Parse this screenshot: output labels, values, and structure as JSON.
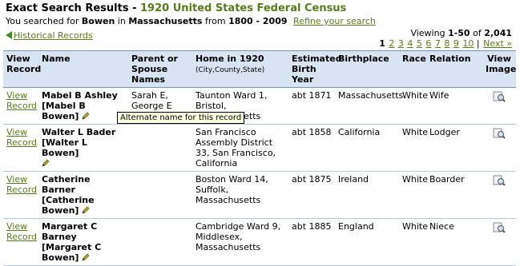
{
  "header": {
    "title_prefix": "Exact Search Results - ",
    "title_db": "1920 United States Federal Census",
    "search_prefix": "You searched for ",
    "search_name": "Bowen",
    "search_in": " in ",
    "search_place": "Massachusetts",
    "search_from": " from ",
    "search_years": "1800 - 2009",
    "refine_link": "Refine your search"
  },
  "nav": {
    "back_label": "Historical Records"
  },
  "paging": {
    "viewing_prefix": "Viewing ",
    "range": "1-50",
    "of": " of ",
    "total": "2,041",
    "current_page": "1",
    "pages": [
      "2",
      "3",
      "4",
      "5",
      "6",
      "7",
      "8",
      "9",
      "10"
    ],
    "next_label": "Next »"
  },
  "columns": {
    "view_record": "View Record",
    "name": "Name",
    "parent": "Parent or Spouse Names",
    "home": "Home in 1920",
    "home_sub": "(City,County,State)",
    "birth_year": "Estimated Birth Year",
    "birthplace": "Birthplace",
    "race": "Race",
    "relation": "Relation",
    "view_image": "View Image"
  },
  "rows": [
    {
      "view": "View Record",
      "name": "Mabel B Ashley",
      "alt": "[Mabel B Bowen]",
      "parents": "Sarah E, George E",
      "home": "Taunton Ward 1, Bristol, Massachusetts",
      "birth_year": "abt 1871",
      "birthplace": "Massachusetts",
      "race": "White",
      "relation": "Wife"
    },
    {
      "view": "View Record",
      "name": "Walter L Bader",
      "alt": "[Walter L Bowen]",
      "parents": "",
      "home": "San Francisco Assembly District 33, San Francisco, California",
      "birth_year": "abt 1858",
      "birthplace": "California",
      "race": "White",
      "relation": "Lodger"
    },
    {
      "view": "View Record",
      "name": "Catherine Barner",
      "alt": "[Catherine Bowen]",
      "parents": "",
      "home": "Boston Ward 14, Suffolk, Massachusetts",
      "birth_year": "abt 1875",
      "birthplace": "Ireland",
      "race": "White",
      "relation": "Boarder"
    },
    {
      "view": "View Record",
      "name": "Margaret C Barney",
      "alt": "[Margaret C Bowen]",
      "parents": "",
      "home": "Cambridge Ward 9, Middlesex, Massachusetts",
      "birth_year": "abt 1885",
      "birthplace": "England",
      "race": "White",
      "relation": "Niece"
    }
  ],
  "tooltip": "Alternate name for this record",
  "icons": {
    "back": "back-arrow-icon",
    "edit": "pencil-icon",
    "image": "magnifier-image-icon"
  }
}
